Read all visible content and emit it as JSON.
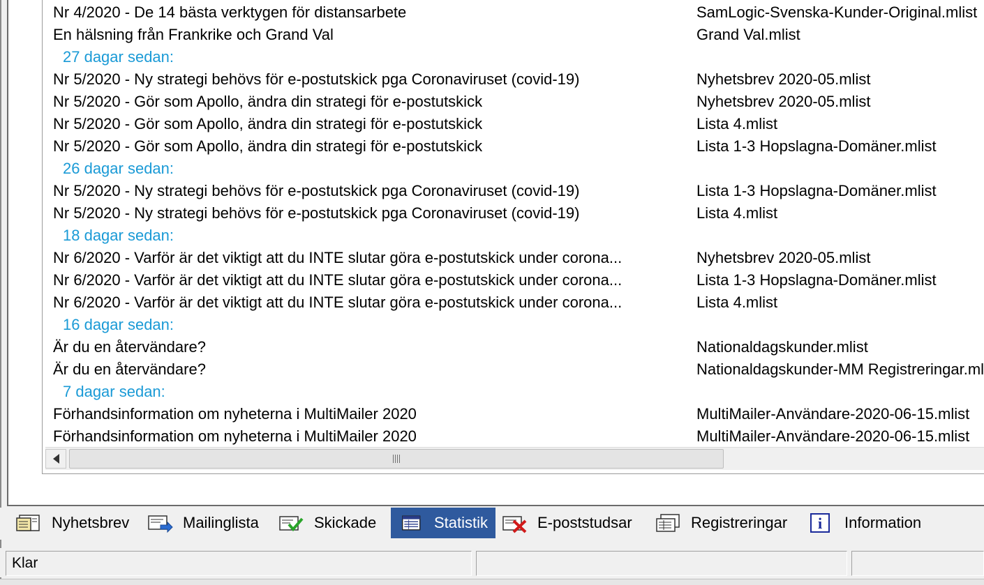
{
  "rows": [
    {
      "kind": "item",
      "title": "Nr 4/2020 - De 14 bästa verktygen för distansarbete",
      "list": "SamLogic-Svenska-Kunder-Original.mlist"
    },
    {
      "kind": "item",
      "title": "En hälsning från Frankrike och Grand Val",
      "list": "Grand Val.mlist"
    },
    {
      "kind": "group",
      "label": "27 dagar sedan:"
    },
    {
      "kind": "item",
      "title": "Nr 5/2020 - Ny strategi behövs för e-postutskick pga Coronaviruset (covid-19)",
      "list": "Nyhetsbrev 2020-05.mlist"
    },
    {
      "kind": "item",
      "title": "Nr 5/2020 - Gör som Apollo, ändra din strategi för e-postutskick",
      "list": "Nyhetsbrev 2020-05.mlist"
    },
    {
      "kind": "item",
      "title": "Nr 5/2020 - Gör som Apollo, ändra din strategi för e-postutskick",
      "list": "Lista 4.mlist"
    },
    {
      "kind": "item",
      "title": "Nr 5/2020 - Gör som Apollo, ändra din strategi för e-postutskick",
      "list": "Lista 1-3 Hopslagna-Domäner.mlist"
    },
    {
      "kind": "group",
      "label": "26 dagar sedan:"
    },
    {
      "kind": "item",
      "title": "Nr 5/2020 - Ny strategi behövs för e-postutskick pga Coronaviruset (covid-19)",
      "list": "Lista 1-3 Hopslagna-Domäner.mlist"
    },
    {
      "kind": "item",
      "title": "Nr 5/2020 - Ny strategi behövs för e-postutskick pga Coronaviruset (covid-19)",
      "list": "Lista 4.mlist"
    },
    {
      "kind": "group",
      "label": "18 dagar sedan:"
    },
    {
      "kind": "item",
      "title": "Nr 6/2020 - Varför är det viktigt att du INTE slutar göra e-postutskick under corona...",
      "list": "Nyhetsbrev 2020-05.mlist"
    },
    {
      "kind": "item",
      "title": "Nr 6/2020 - Varför är det viktigt att du INTE slutar göra e-postutskick under corona...",
      "list": "Lista 1-3 Hopslagna-Domäner.mlist"
    },
    {
      "kind": "item",
      "title": "Nr 6/2020 - Varför är det viktigt att du INTE slutar göra e-postutskick under corona...",
      "list": "Lista 4.mlist"
    },
    {
      "kind": "group",
      "label": "16 dagar sedan:"
    },
    {
      "kind": "item",
      "title": "Är du en återvändare?",
      "list": "Nationaldagskunder.mlist"
    },
    {
      "kind": "item",
      "title": "Är du en återvändare?",
      "list": "Nationaldagskunder-MM Registreringar.mlist"
    },
    {
      "kind": "group",
      "label": "7 dagar sedan:"
    },
    {
      "kind": "item",
      "title": "Förhandsinformation om nyheterna i MultiMailer 2020",
      "list": "MultiMailer-Användare-2020-06-15.mlist"
    },
    {
      "kind": "item",
      "title": "Förhandsinformation om nyheterna i MultiMailer 2020",
      "list": "MultiMailer-Användare-2020-06-15.mlist"
    }
  ],
  "tabs": [
    {
      "label": "Nyhetsbrev",
      "icon": "newsletter-icon",
      "active": false
    },
    {
      "label": "Mailinglista",
      "icon": "mailing-list-icon",
      "active": false
    },
    {
      "label": "Skickade",
      "icon": "sent-check-icon",
      "active": false
    },
    {
      "label": "Statistik",
      "icon": "statistics-icon",
      "active": true
    },
    {
      "label": "E-poststudsar",
      "icon": "bounce-x-icon",
      "active": false
    },
    {
      "label": "Registreringar",
      "icon": "registrations-icon",
      "active": false
    },
    {
      "label": "Information",
      "icon": "info-icon",
      "active": false
    }
  ],
  "status": {
    "text": "Klar"
  },
  "colors": {
    "group_header": "#1a9ad6",
    "active_tab": "#2f5a9e"
  }
}
